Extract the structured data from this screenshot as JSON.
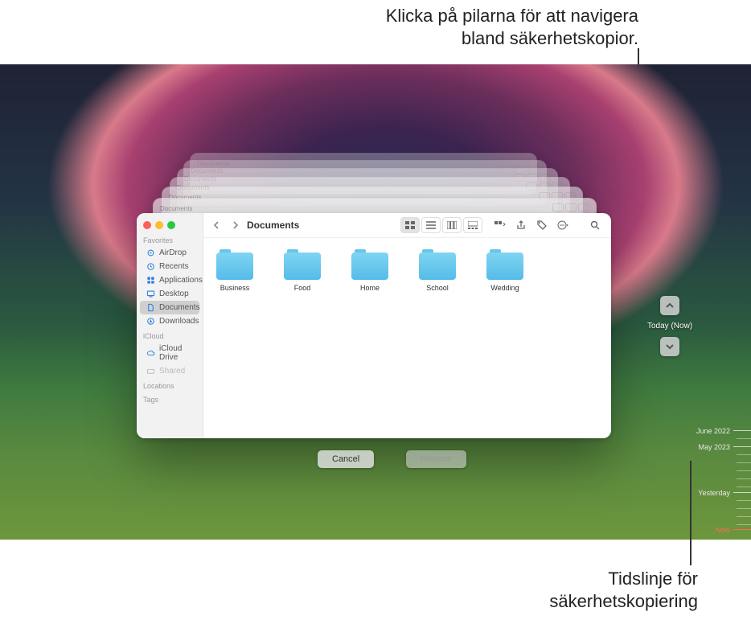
{
  "callouts": {
    "top_line1": "Klicka på pilarna för att navigera",
    "top_line2": "bland säkerhetskopior.",
    "bottom_line1": "Tidslinje för",
    "bottom_line2": "säkerhetskopiering"
  },
  "finder": {
    "title": "Documents",
    "sidebar": {
      "favorites_header": "Favorites",
      "airdrop": "AirDrop",
      "recents": "Recents",
      "applications": "Applications",
      "desktop": "Desktop",
      "documents": "Documents",
      "downloads": "Downloads",
      "icloud_header": "iCloud",
      "icloud_drive": "iCloud Drive",
      "shared": "Shared",
      "locations_header": "Locations",
      "tags_header": "Tags"
    },
    "folders": {
      "f0": "Business",
      "f1": "Food",
      "f2": "Home",
      "f3": "School",
      "f4": "Wedding"
    }
  },
  "nav": {
    "now": "Today (Now)"
  },
  "buttons": {
    "cancel": "Cancel",
    "restore": "Restore"
  },
  "timeline": {
    "t0": "June 2022",
    "t1": "May 2023",
    "t2": "Yesterday",
    "t3": "Now"
  },
  "stack_title": "Documents"
}
